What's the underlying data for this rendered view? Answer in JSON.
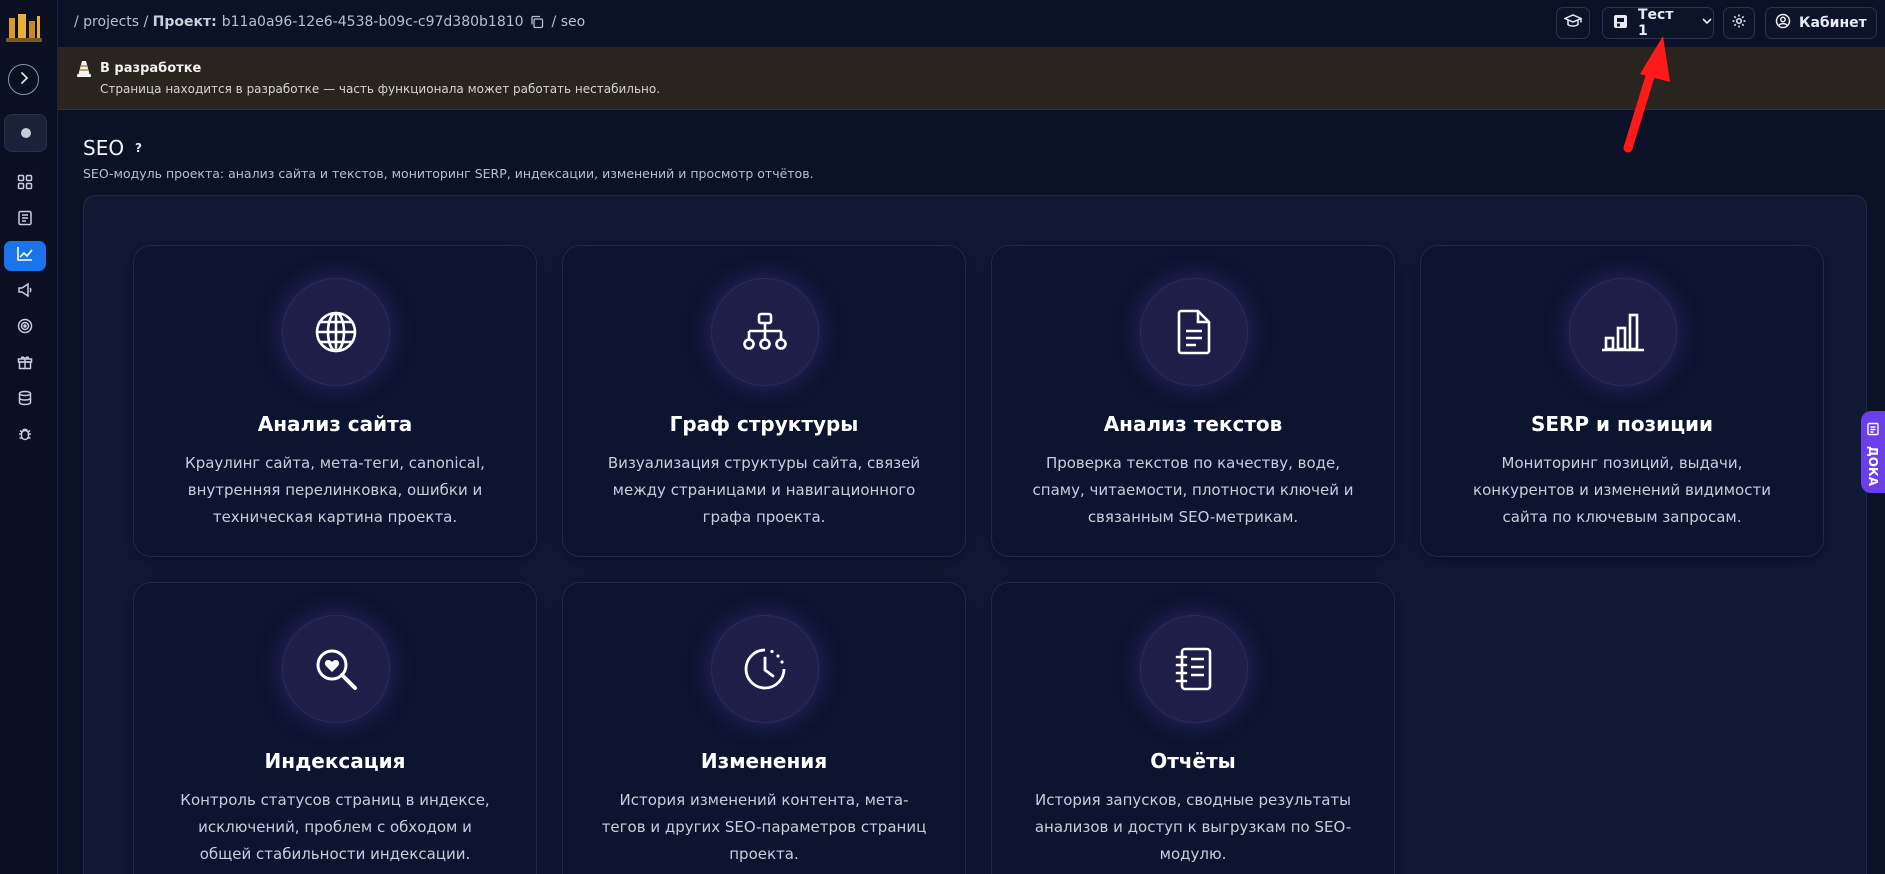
{
  "breadcrumb": {
    "projects": "/ projects /",
    "project_label": "Проект:",
    "project_id": "b11a0a96-12e6-4538-b09c-c97d380b1810",
    "current": "/ seo"
  },
  "topbar": {
    "project_selector": "Тест 1",
    "cabinet_label": "Кабинет"
  },
  "banner": {
    "title": "В разработке",
    "text": "Страница находится в разработке — часть функционала может работать нестабильно."
  },
  "page": {
    "title": "SEO",
    "help": "?",
    "subtitle": "SEO-модуль проекта: анализ сайта и текстов, мониторинг SERP, индексации, изменений и просмотр отчётов."
  },
  "cards": [
    {
      "icon": "globe-icon",
      "title": "Анализ сайта",
      "desc": "Краулинг сайта, мета-теги, canonical, внутренняя перелинковка, ошибки и техническая картина проекта."
    },
    {
      "icon": "sitemap-icon",
      "title": "Граф структуры",
      "desc": "Визуализация структуры сайта, связей между страницами и навигационного графа проекта."
    },
    {
      "icon": "document-icon",
      "title": "Анализ текстов",
      "desc": "Проверка текстов по качеству, воде, спаму, читаемости, плотности ключей и связанным SEO-метрикам."
    },
    {
      "icon": "bar-chart-icon",
      "title": "SERP и позиции",
      "desc": "Мониторинг позиций, выдачи, конкурентов и изменений видимости сайта по ключевым запросам."
    },
    {
      "icon": "search-heart-icon",
      "title": "Индексация",
      "desc": "Контроль статусов страниц в индексе, исключений, проблем с обходом и общей стабильности индексации."
    },
    {
      "icon": "clock-icon",
      "title": "Изменения",
      "desc": "История изменений контента, мета-тегов и других SEO-параметров страниц проекта."
    },
    {
      "icon": "notebook-icon",
      "title": "Отчёты",
      "desc": "История запусков, сводные результаты анализов и доступ к выгрузкам по SEO-модулю."
    }
  ],
  "docs_tab": {
    "label": "ДОКА"
  },
  "colors": {
    "accent": "#1a73e8",
    "docs_tab": "#6a3ee8",
    "annotation_arrow": "#ff1a1a"
  }
}
